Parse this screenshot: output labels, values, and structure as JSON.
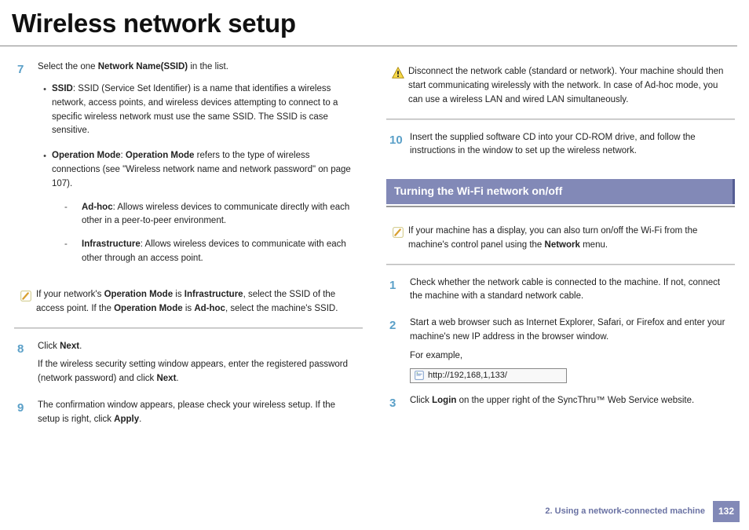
{
  "title": "Wireless network setup",
  "left": {
    "step7": {
      "num": "7",
      "intro_pre": "Select the one ",
      "intro_b": "Network Name(SSID)",
      "intro_post": " in the list.",
      "ssid_label": "SSID",
      "ssid_text": ": SSID (Service Set Identifier) is a name that identifies a wireless network, access points, and wireless devices attempting to connect to a specific wireless network must use the same SSID. The SSID is case sensitive.",
      "opmode_label": "Operation Mode",
      "opmode_text1": ": ",
      "opmode_bold2": "Operation Mode",
      "opmode_text2": " refers to the type of wireless connections (see \"Wireless network name and network password\" on page 107).",
      "adhoc_label": "Ad-hoc",
      "adhoc_text": ": Allows wireless devices to communicate directly with each other in a peer-to-peer environment.",
      "infra_label": "Infrastructure",
      "infra_text": ": Allows wireless devices to communicate with each other through an access point."
    },
    "note1_a": "If your network's ",
    "note1_b1": "Operation Mode",
    "note1_c": " is ",
    "note1_b2": "Infrastructure",
    "note1_d": ", select the SSID of the access point. If the ",
    "note1_b3": "Operation Mode",
    "note1_e": " is ",
    "note1_b4": "Ad-hoc",
    "note1_f": ", select the machine's SSID.",
    "step8": {
      "num": "8",
      "l1a": "Click ",
      "l1b": "Next",
      "l1c": ".",
      "l2a": "If the wireless security setting window appears, enter the registered password (network password) and click ",
      "l2b": "Next",
      "l2c": "."
    },
    "step9": {
      "num": "9",
      "a": "The confirmation window appears, please check your wireless setup. If the setup is right, click ",
      "b": "Apply",
      "c": "."
    }
  },
  "right": {
    "warn": "Disconnect the network cable (standard or network). Your machine should then start communicating wirelessly with the network. In case of Ad-hoc mode, you can use a wireless LAN and wired LAN simultaneously.",
    "step10": {
      "num": "10",
      "text": "Insert the supplied software CD into your CD-ROM drive, and follow the instructions in the window to set up the wireless network."
    },
    "section": "Turning the Wi-Fi network on/off",
    "note2_a": "If your machine has a display, you can also turn on/off the Wi-Fi from the machine's control panel using the ",
    "note2_b": "Network",
    "note2_c": " menu.",
    "s1": {
      "num": "1",
      "text": "Check whether the network cable is connected to the machine. If not, connect the machine with a standard network cable."
    },
    "s2": {
      "num": "2",
      "text": "Start a web browser such as Internet Explorer, Safari, or Firefox and enter your machine's new IP address in the browser window.",
      "eg": "For example,",
      "url": "http://192,168,1,133/"
    },
    "s3": {
      "num": "3",
      "a": "Click ",
      "b": "Login",
      "c": " on the upper right of the SyncThru™ Web Service website."
    }
  },
  "footer": {
    "chapter": "2.  Using a network-connected machine",
    "page": "132"
  }
}
